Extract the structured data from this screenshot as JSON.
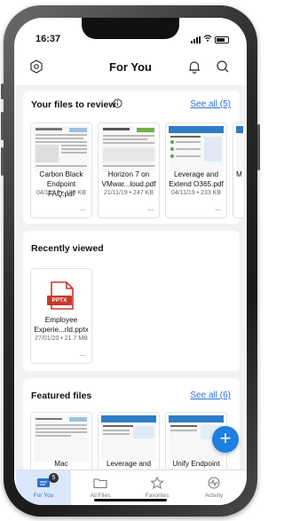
{
  "status_bar": {
    "time": "16:37"
  },
  "header": {
    "title": "For You"
  },
  "sections": {
    "files_to_review": {
      "title": "Your files to review",
      "see_all": "See all (5)",
      "files": [
        {
          "name_line1": "Carbon Black",
          "name_line2": "Endpoint FAQ.pdf",
          "meta": "04/11/19 • 189 KB"
        },
        {
          "name_line1": "Horizon 7 on",
          "name_line2": "VMwar...loud.pdf",
          "meta": "21/11/19 • 247 KB"
        },
        {
          "name_line1": "Leverage and",
          "name_line2": "Extend O365.pdf",
          "meta": "04/11/19 • 233 KB"
        },
        {
          "name_line1": "M",
          "name_line2": "",
          "meta": ""
        }
      ]
    },
    "recently_viewed": {
      "title": "Recently viewed",
      "file": {
        "badge": "PPTX",
        "name_line1": "Employee",
        "name_line2": "Experie...rld.pptx",
        "meta": "27/01/20 • 21.7 MB"
      }
    },
    "featured_files": {
      "title": "Featured files",
      "see_all": "See all (6)",
      "files": [
        {
          "name_line1": "Mac"
        },
        {
          "name_line1": "Leverage and"
        },
        {
          "name_line1": "Unify Endpoint"
        }
      ]
    }
  },
  "more_glyph": "...",
  "fab_label": "+",
  "tabs": [
    {
      "label": "For You",
      "badge": "5",
      "active": true
    },
    {
      "label": "All Files"
    },
    {
      "label": "Favorites"
    },
    {
      "label": "Activity"
    }
  ],
  "colors": {
    "accent": "#2b6fd6",
    "fab": "#1f7fe0",
    "pptx": "#c8392b",
    "active_tab_bg": "#dbe8fb"
  }
}
